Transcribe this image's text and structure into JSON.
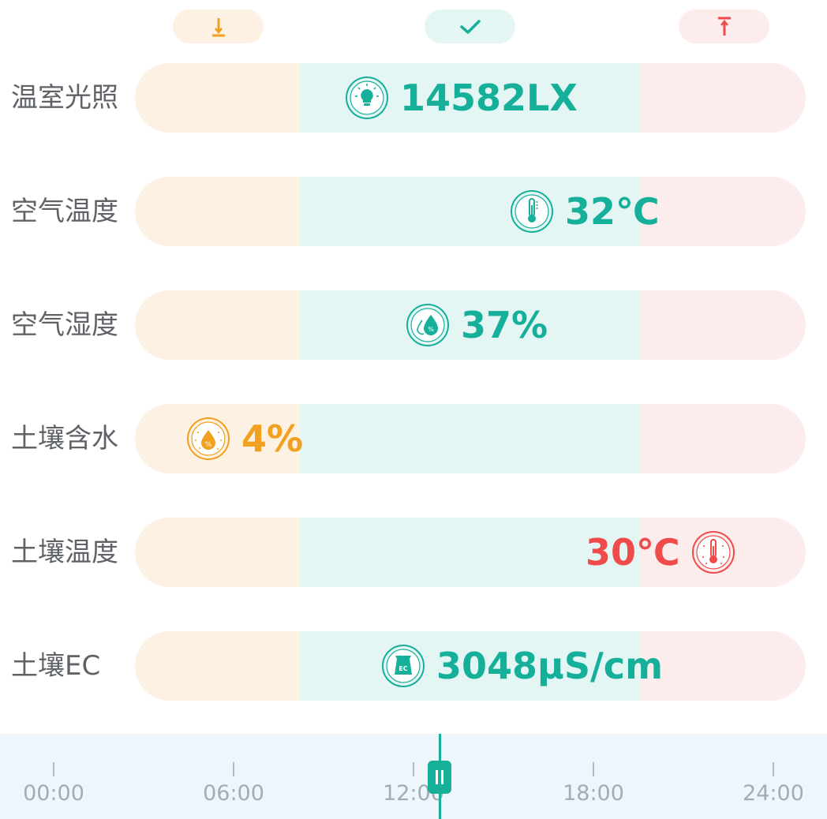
{
  "legend": {
    "low_icon": "arrow-down-to-line-icon",
    "ok_icon": "check-icon",
    "high_icon": "arrow-up-to-line-icon"
  },
  "colors": {
    "low": "#f2a020",
    "normal": "#16b09a",
    "high": "#ef4b4b",
    "low_band": "#fdf1e3",
    "normal_band": "#e3f6f3",
    "high_band": "#fdecec"
  },
  "metrics": [
    {
      "label": "温室光照",
      "value": "14582LX",
      "status": "normal",
      "icon": "lightbulb-icon"
    },
    {
      "label": "空气温度",
      "value": "32℃",
      "status": "normal",
      "icon": "thermometer-icon"
    },
    {
      "label": "空气湿度",
      "value": "37%",
      "status": "normal",
      "icon": "humidity-drop-icon"
    },
    {
      "label": "土壤含水",
      "value": "4%",
      "status": "low",
      "icon": "soil-moisture-icon"
    },
    {
      "label": "土壤温度",
      "value": "30℃",
      "status": "high",
      "icon": "soil-thermometer-icon"
    },
    {
      "label": "土壤EC",
      "value": "3048μS/cm",
      "status": "normal",
      "icon": "soil-ec-bag-icon"
    }
  ],
  "timeline": {
    "ticks": [
      "00:00",
      "06:00",
      "12:00",
      "18:00",
      "24:00"
    ],
    "cursor_icon": "pause-handle-icon"
  }
}
